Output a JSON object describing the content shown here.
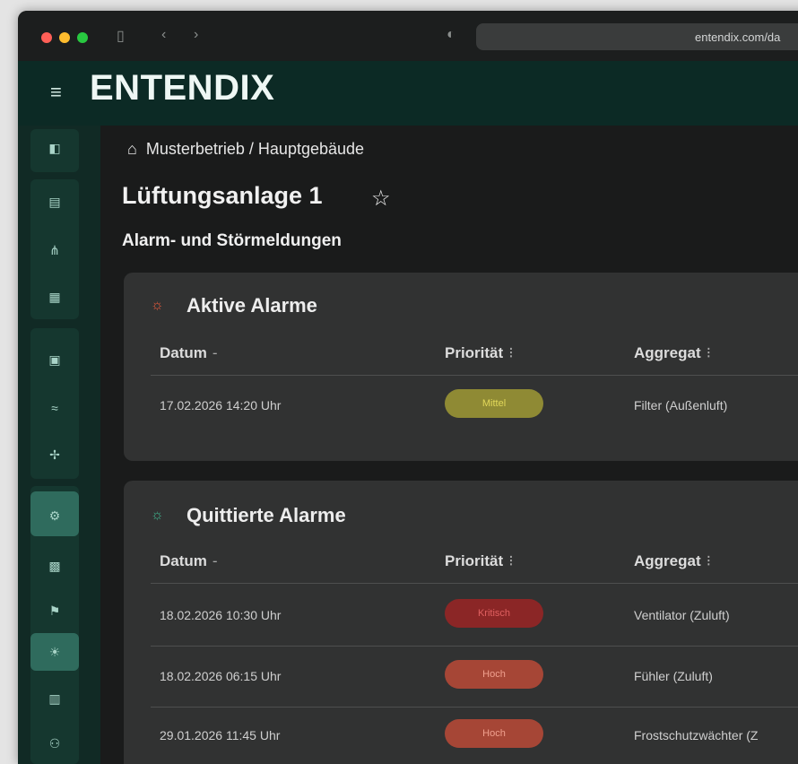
{
  "browser": {
    "url": "entendix.com/da"
  },
  "app": {
    "logo": "ENTENDIX"
  },
  "breadcrumb": "Musterbetrieb / Hauptgebäude",
  "page": {
    "title": "Lüftungsanlage 1",
    "subtitle": "Alarm- und Störmeldungen"
  },
  "active_alarms": {
    "title": "Aktive Alarme",
    "columns": [
      "Datum",
      "Priorität",
      "Aggregat"
    ],
    "rows": [
      {
        "date": "17.02.2026 14:20 Uhr",
        "priority": "Mittel",
        "aggregate": "Filter (Außenluft)"
      }
    ]
  },
  "acknowledged_alarms": {
    "title": "Quittierte Alarme",
    "columns": [
      "Datum",
      "Priorität",
      "Aggregat"
    ],
    "rows": [
      {
        "date": "18.02.2026 10:30 Uhr",
        "priority": "Kritisch",
        "aggregate": "Ventilator (Zuluft)"
      },
      {
        "date": "18.02.2026 06:15 Uhr",
        "priority": "Hoch",
        "aggregate": "Fühler (Zuluft)"
      },
      {
        "date": "29.01.2026 11:45 Uhr",
        "priority": "Hoch",
        "aggregate": "Frostschutzwächter (Z"
      }
    ]
  },
  "icons": {
    "nav": [
      "dashboard-icon",
      "report-icon",
      "network-icon",
      "list-icon",
      "building-icon",
      "airflow-icon",
      "fan-icon",
      "settings-icon",
      "grid-icon",
      "flag-icon",
      "alarm-icon",
      "calendar-icon",
      "users-icon"
    ]
  },
  "colors": {
    "brand_dark": "#0c2a25",
    "sidebar_active": "#2f6b5d",
    "priority_mittel": "#8f8a34",
    "priority_kritisch": "#8b2626",
    "priority_hoch": "#a64636"
  }
}
